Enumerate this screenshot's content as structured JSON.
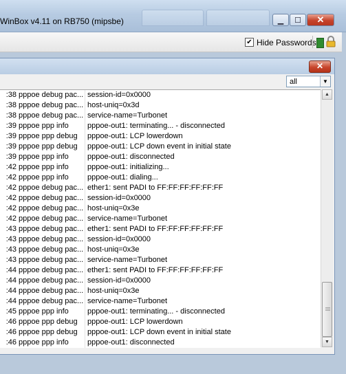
{
  "window": {
    "title": "WinBox v4.11 on RB750 (mipsbe)",
    "buttons": {
      "minimize": "▁",
      "maximize": "☐",
      "close": "✕"
    }
  },
  "toolbar": {
    "hide_passwords_label": "Hide Passwords",
    "hide_passwords_checked": "✔",
    "status_color": "#2f8c2f"
  },
  "log": {
    "close_label": "✕",
    "filter_value": "all",
    "entries": [
      {
        "time": ":38",
        "topic": "pppoe debug pac...",
        "message": "   session-id=0x0000"
      },
      {
        "time": ":38",
        "topic": "pppoe debug pac...",
        "message": "   host-uniq=0x3d"
      },
      {
        "time": ":38",
        "topic": "pppoe debug pac...",
        "message": "   service-name=Turbonet"
      },
      {
        "time": ":39",
        "topic": "pppoe ppp info",
        "message": "pppoe-out1: terminating... - disconnected"
      },
      {
        "time": ":39",
        "topic": "pppoe ppp debug",
        "message": "pppoe-out1: LCP lowerdown"
      },
      {
        "time": ":39",
        "topic": "pppoe ppp debug",
        "message": "pppoe-out1: LCP down event in initial state"
      },
      {
        "time": ":39",
        "topic": "pppoe ppp info",
        "message": "pppoe-out1: disconnected"
      },
      {
        "time": ":42",
        "topic": "pppoe ppp info",
        "message": "pppoe-out1: initializing..."
      },
      {
        "time": ":42",
        "topic": "pppoe ppp info",
        "message": "pppoe-out1: dialing..."
      },
      {
        "time": ":42",
        "topic": "pppoe debug pac...",
        "message": "ether1: sent PADI to FF:FF:FF:FF:FF:FF"
      },
      {
        "time": ":42",
        "topic": "pppoe debug pac...",
        "message": "   session-id=0x0000"
      },
      {
        "time": ":42",
        "topic": "pppoe debug pac...",
        "message": "   host-uniq=0x3e"
      },
      {
        "time": ":42",
        "topic": "pppoe debug pac...",
        "message": "   service-name=Turbonet"
      },
      {
        "time": ":43",
        "topic": "pppoe debug pac...",
        "message": "ether1: sent PADI to FF:FF:FF:FF:FF:FF"
      },
      {
        "time": ":43",
        "topic": "pppoe debug pac...",
        "message": "   session-id=0x0000"
      },
      {
        "time": ":43",
        "topic": "pppoe debug pac...",
        "message": "   host-uniq=0x3e"
      },
      {
        "time": ":43",
        "topic": "pppoe debug pac...",
        "message": "   service-name=Turbonet"
      },
      {
        "time": ":44",
        "topic": "pppoe debug pac...",
        "message": "ether1: sent PADI to FF:FF:FF:FF:FF:FF"
      },
      {
        "time": ":44",
        "topic": "pppoe debug pac...",
        "message": "   session-id=0x0000"
      },
      {
        "time": ":44",
        "topic": "pppoe debug pac...",
        "message": "   host-uniq=0x3e"
      },
      {
        "time": ":44",
        "topic": "pppoe debug pac...",
        "message": "   service-name=Turbonet"
      },
      {
        "time": ":45",
        "topic": "pppoe ppp info",
        "message": "pppoe-out1: terminating... - disconnected"
      },
      {
        "time": ":46",
        "topic": "pppoe ppp debug",
        "message": "pppoe-out1: LCP lowerdown"
      },
      {
        "time": ":46",
        "topic": "pppoe ppp debug",
        "message": "pppoe-out1: LCP down event in initial state"
      },
      {
        "time": ":46",
        "topic": "pppoe ppp info",
        "message": "pppoe-out1: disconnected"
      }
    ]
  }
}
